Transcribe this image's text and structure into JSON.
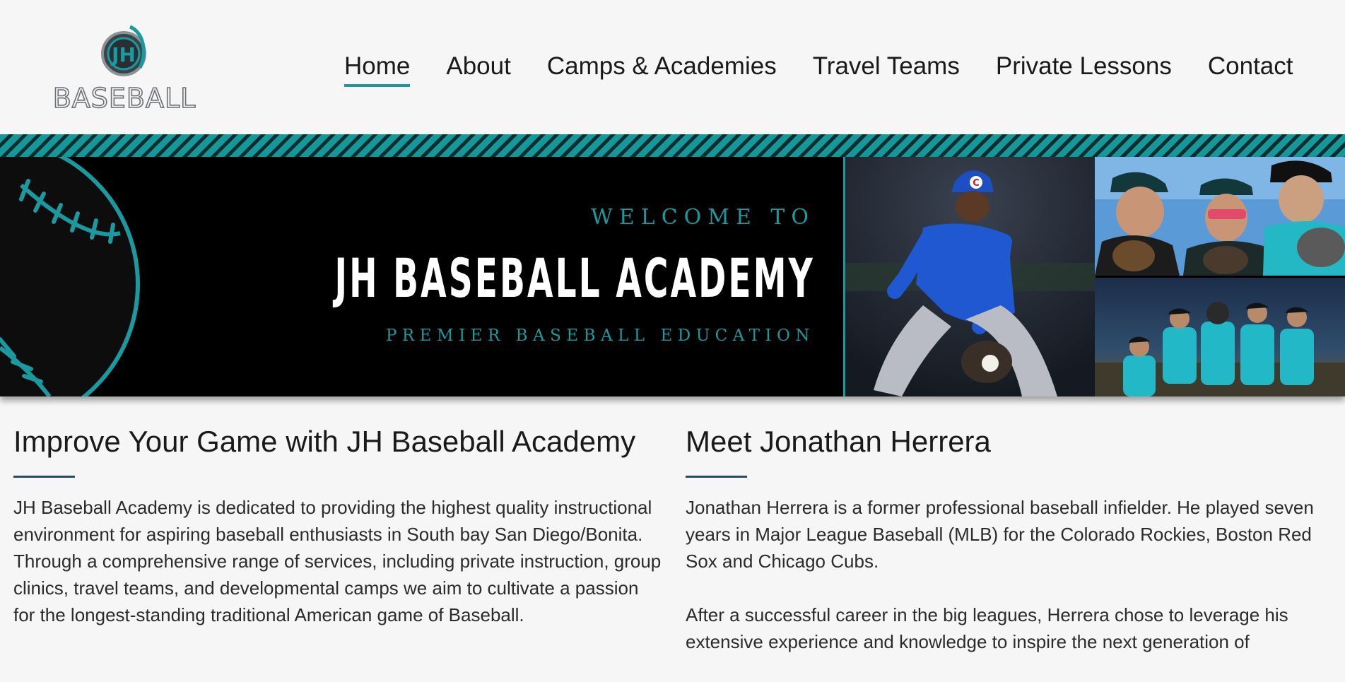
{
  "header": {
    "logo_alt": "JH Baseball",
    "logo_monogram": "JH",
    "logo_wordmark": "BASEBALL",
    "nav": [
      {
        "label": "Home",
        "active": true
      },
      {
        "label": "About",
        "active": false
      },
      {
        "label": "Camps & Academies",
        "active": false
      },
      {
        "label": "Travel Teams",
        "active": false
      },
      {
        "label": "Private Lessons",
        "active": false
      },
      {
        "label": "Contact",
        "active": false
      }
    ]
  },
  "hero": {
    "welcome": "WELCOME TO",
    "title": "JH BASEBALL ACADEMY",
    "tagline": "PREMIER BASEBALL EDUCATION",
    "photos": [
      "infielder-fielding-ground-ball-photo",
      "youth-players-closeup-photo",
      "youth-team-group-photo"
    ]
  },
  "colors": {
    "accent": "#1a9a9e",
    "rule": "#1f4f6b",
    "hero_bg": "#000000",
    "page_bg": "#f6f6f6"
  },
  "main": {
    "left": {
      "heading": "Improve Your Game with JH Baseball Academy",
      "paragraphs": [
        "JH Baseball Academy is dedicated to providing the highest quality instructional environment for aspiring baseball enthusiasts in South bay San Diego/Bonita. Through a comprehensive range of services, including private instruction, group clinics, travel teams, and developmental camps we aim to cultivate a passion for the longest-standing traditional American game of Baseball."
      ]
    },
    "right": {
      "heading": "Meet Jonathan Herrera",
      "paragraphs": [
        "Jonathan Herrera is a former professional baseball infielder. He played seven years in Major League Baseball (MLB) for the Colorado Rockies, Boston Red Sox and Chicago Cubs.",
        "After a successful career in the big leagues, Herrera chose to leverage his extensive experience and knowledge to inspire the next generation of"
      ]
    }
  }
}
